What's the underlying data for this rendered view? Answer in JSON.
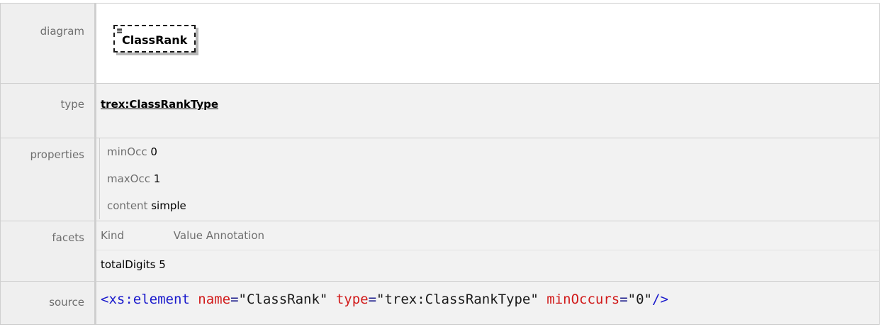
{
  "diagram": {
    "label": "diagram",
    "element_name": "ClassRank",
    "element_icon": "list-icon"
  },
  "type": {
    "label": "type",
    "value": "trex:ClassRankType"
  },
  "properties": {
    "label": "properties",
    "items": [
      {
        "key": "minOcc",
        "value": "0"
      },
      {
        "key": "maxOcc",
        "value": "1"
      },
      {
        "key": "content",
        "value": "simple"
      }
    ]
  },
  "facets": {
    "label": "facets",
    "headers": [
      "Kind",
      "Value",
      "Annotation"
    ],
    "rows": [
      {
        "kind": "totalDigits",
        "value": "5",
        "annotation": ""
      }
    ]
  },
  "source": {
    "label": "source",
    "tag_open": "<xs:element",
    "attr1_name": "name",
    "attr1_value": "\"ClassRank\"",
    "attr2_name": "type",
    "attr2_value": "\"trex:ClassRankType\"",
    "attr3_name": "minOccurs",
    "attr3_value": "\"0\"",
    "tag_close": "/>"
  }
}
